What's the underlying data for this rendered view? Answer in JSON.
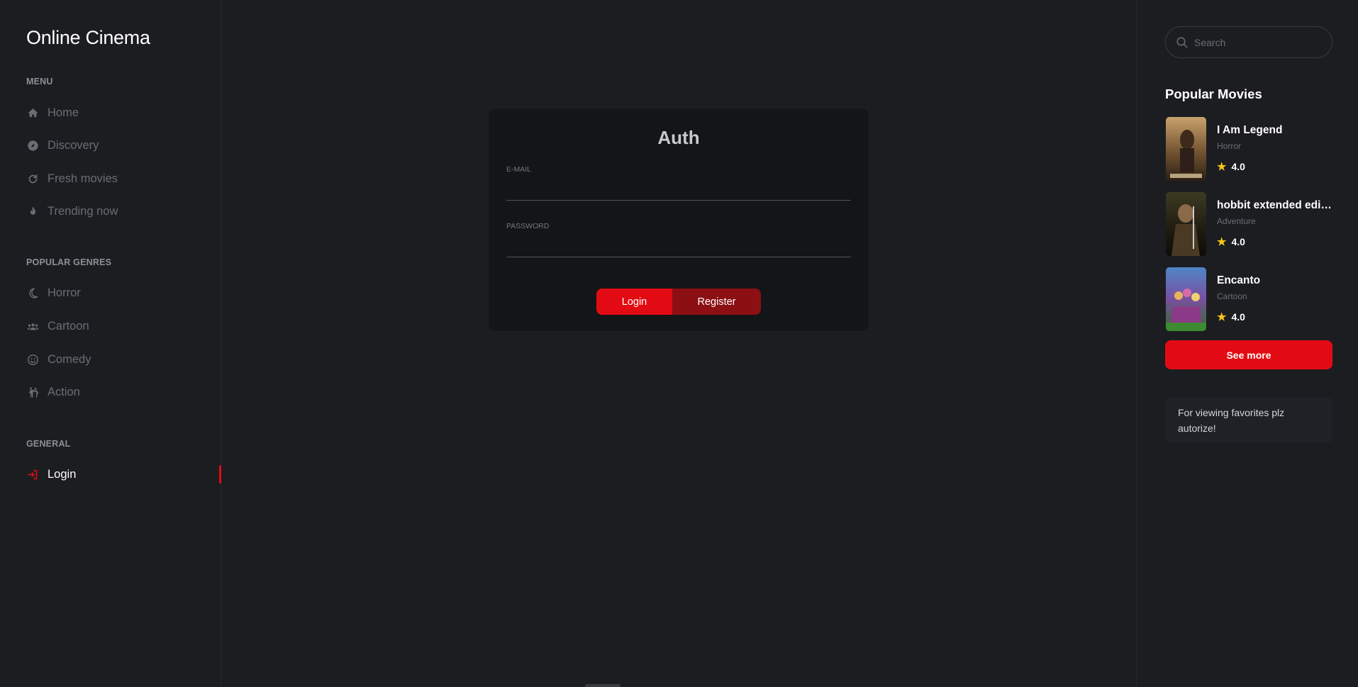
{
  "app": {
    "title": "Online Cinema"
  },
  "sidebar": {
    "menu_heading": "Menu",
    "menu_items": [
      {
        "label": "Home",
        "icon": "home-icon"
      },
      {
        "label": "Discovery",
        "icon": "compass-icon"
      },
      {
        "label": "Fresh movies",
        "icon": "refresh-icon"
      },
      {
        "label": "Trending now",
        "icon": "fire-icon"
      }
    ],
    "genres_heading": "Popular genres",
    "genre_items": [
      {
        "label": "Horror",
        "icon": "moon-icon"
      },
      {
        "label": "Cartoon",
        "icon": "group-icon"
      },
      {
        "label": "Comedy",
        "icon": "smile-icon"
      },
      {
        "label": "Action",
        "icon": "fight-icon"
      }
    ],
    "general_heading": "General",
    "general_items": [
      {
        "label": "Login",
        "icon": "login-icon",
        "active": true
      }
    ]
  },
  "auth": {
    "title": "Auth",
    "email_label": "E-mail",
    "email_value": "",
    "password_label": "Password",
    "password_value": "",
    "login_label": "Login",
    "register_label": "Register"
  },
  "right_sidebar": {
    "search_placeholder": "Search",
    "popular_title": "Popular Movies",
    "movies": [
      {
        "title": "I Am Legend",
        "genre": "Horror",
        "rating": "4.0"
      },
      {
        "title": "hobbit extended edition",
        "genre": "Adventure",
        "rating": "4.0"
      },
      {
        "title": "Encanto",
        "genre": "Cartoon",
        "rating": "4.0"
      }
    ],
    "see_more_label": "See more",
    "favorites_note": "For viewing favorites plz autorize!"
  },
  "colors": {
    "accent": "#e30b13",
    "accent_dark": "#8c0f14",
    "background": "#1c1d21",
    "card": "#141518",
    "star": "#f5c518"
  }
}
